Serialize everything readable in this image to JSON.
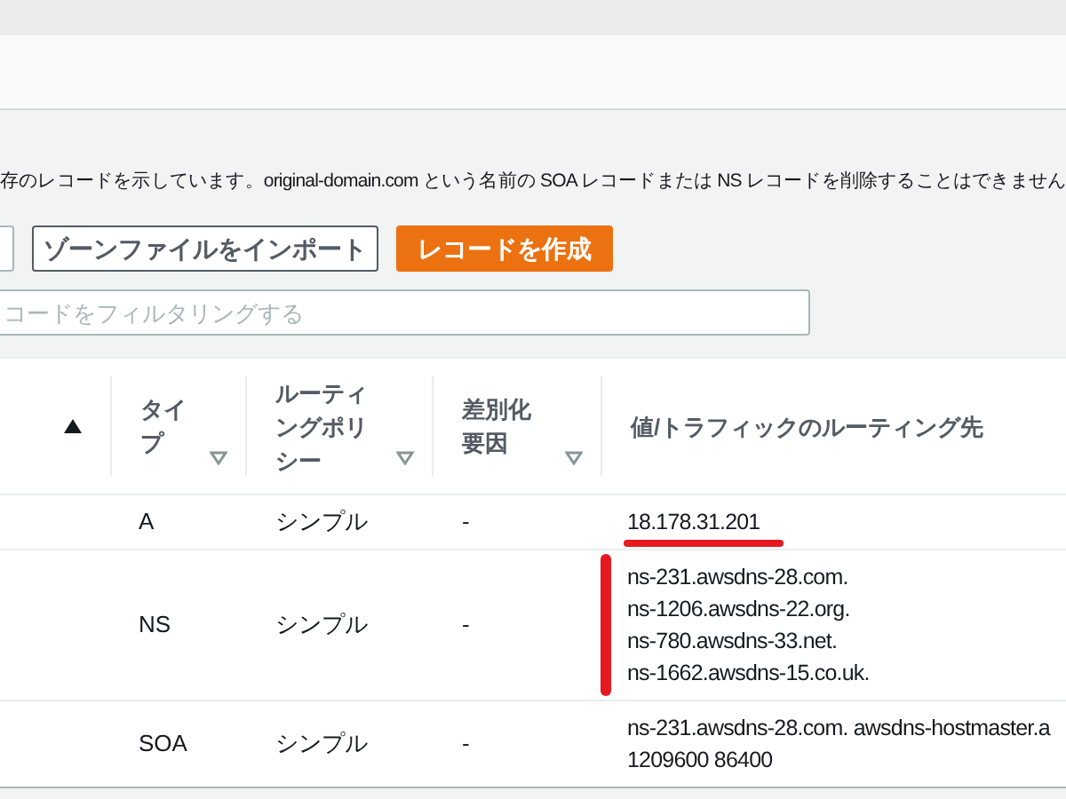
{
  "description": "存のレコードを示しています。original-domain.com という名前の SOA レコードまたは NS レコードを削除することはできません",
  "buttons": [
    {
      "label": "ゾーンファイルをインポート",
      "kind": "secondary"
    },
    {
      "label": "レコードを作成",
      "kind": "primary"
    }
  ],
  "filter": {
    "placeholder": "コードをフィルタリングする"
  },
  "table": {
    "columns": [
      {
        "sorted": true,
        "filter": false
      },
      {
        "label": "タイプ",
        "filter": true
      },
      {
        "label": "ルーティングポリシー",
        "filter": true
      },
      {
        "label": "差別化要因",
        "filter": true
      },
      {
        "label": "値/トラフィックのルーティング先",
        "filter": false
      }
    ],
    "rows": [
      {
        "type": "A",
        "policy": "シンプル",
        "differentiator": "-",
        "value": [
          "18.178.31.201"
        ],
        "underlined": true,
        "marked": false
      },
      {
        "type": "NS",
        "policy": "シンプル",
        "differentiator": "-",
        "value": [
          "ns-231.awsdns-28.com.",
          "ns-1206.awsdns-22.org.",
          "ns-780.awsdns-33.net.",
          "ns-1662.awsdns-15.co.uk."
        ],
        "underlined": false,
        "marked": true
      },
      {
        "type": "SOA",
        "policy": "シンプル",
        "differentiator": "-",
        "value": [
          "ns-231.awsdns-28.com. awsdns-hostmaster.a",
          "1209600 86400"
        ],
        "underlined": false,
        "marked": false
      }
    ]
  }
}
